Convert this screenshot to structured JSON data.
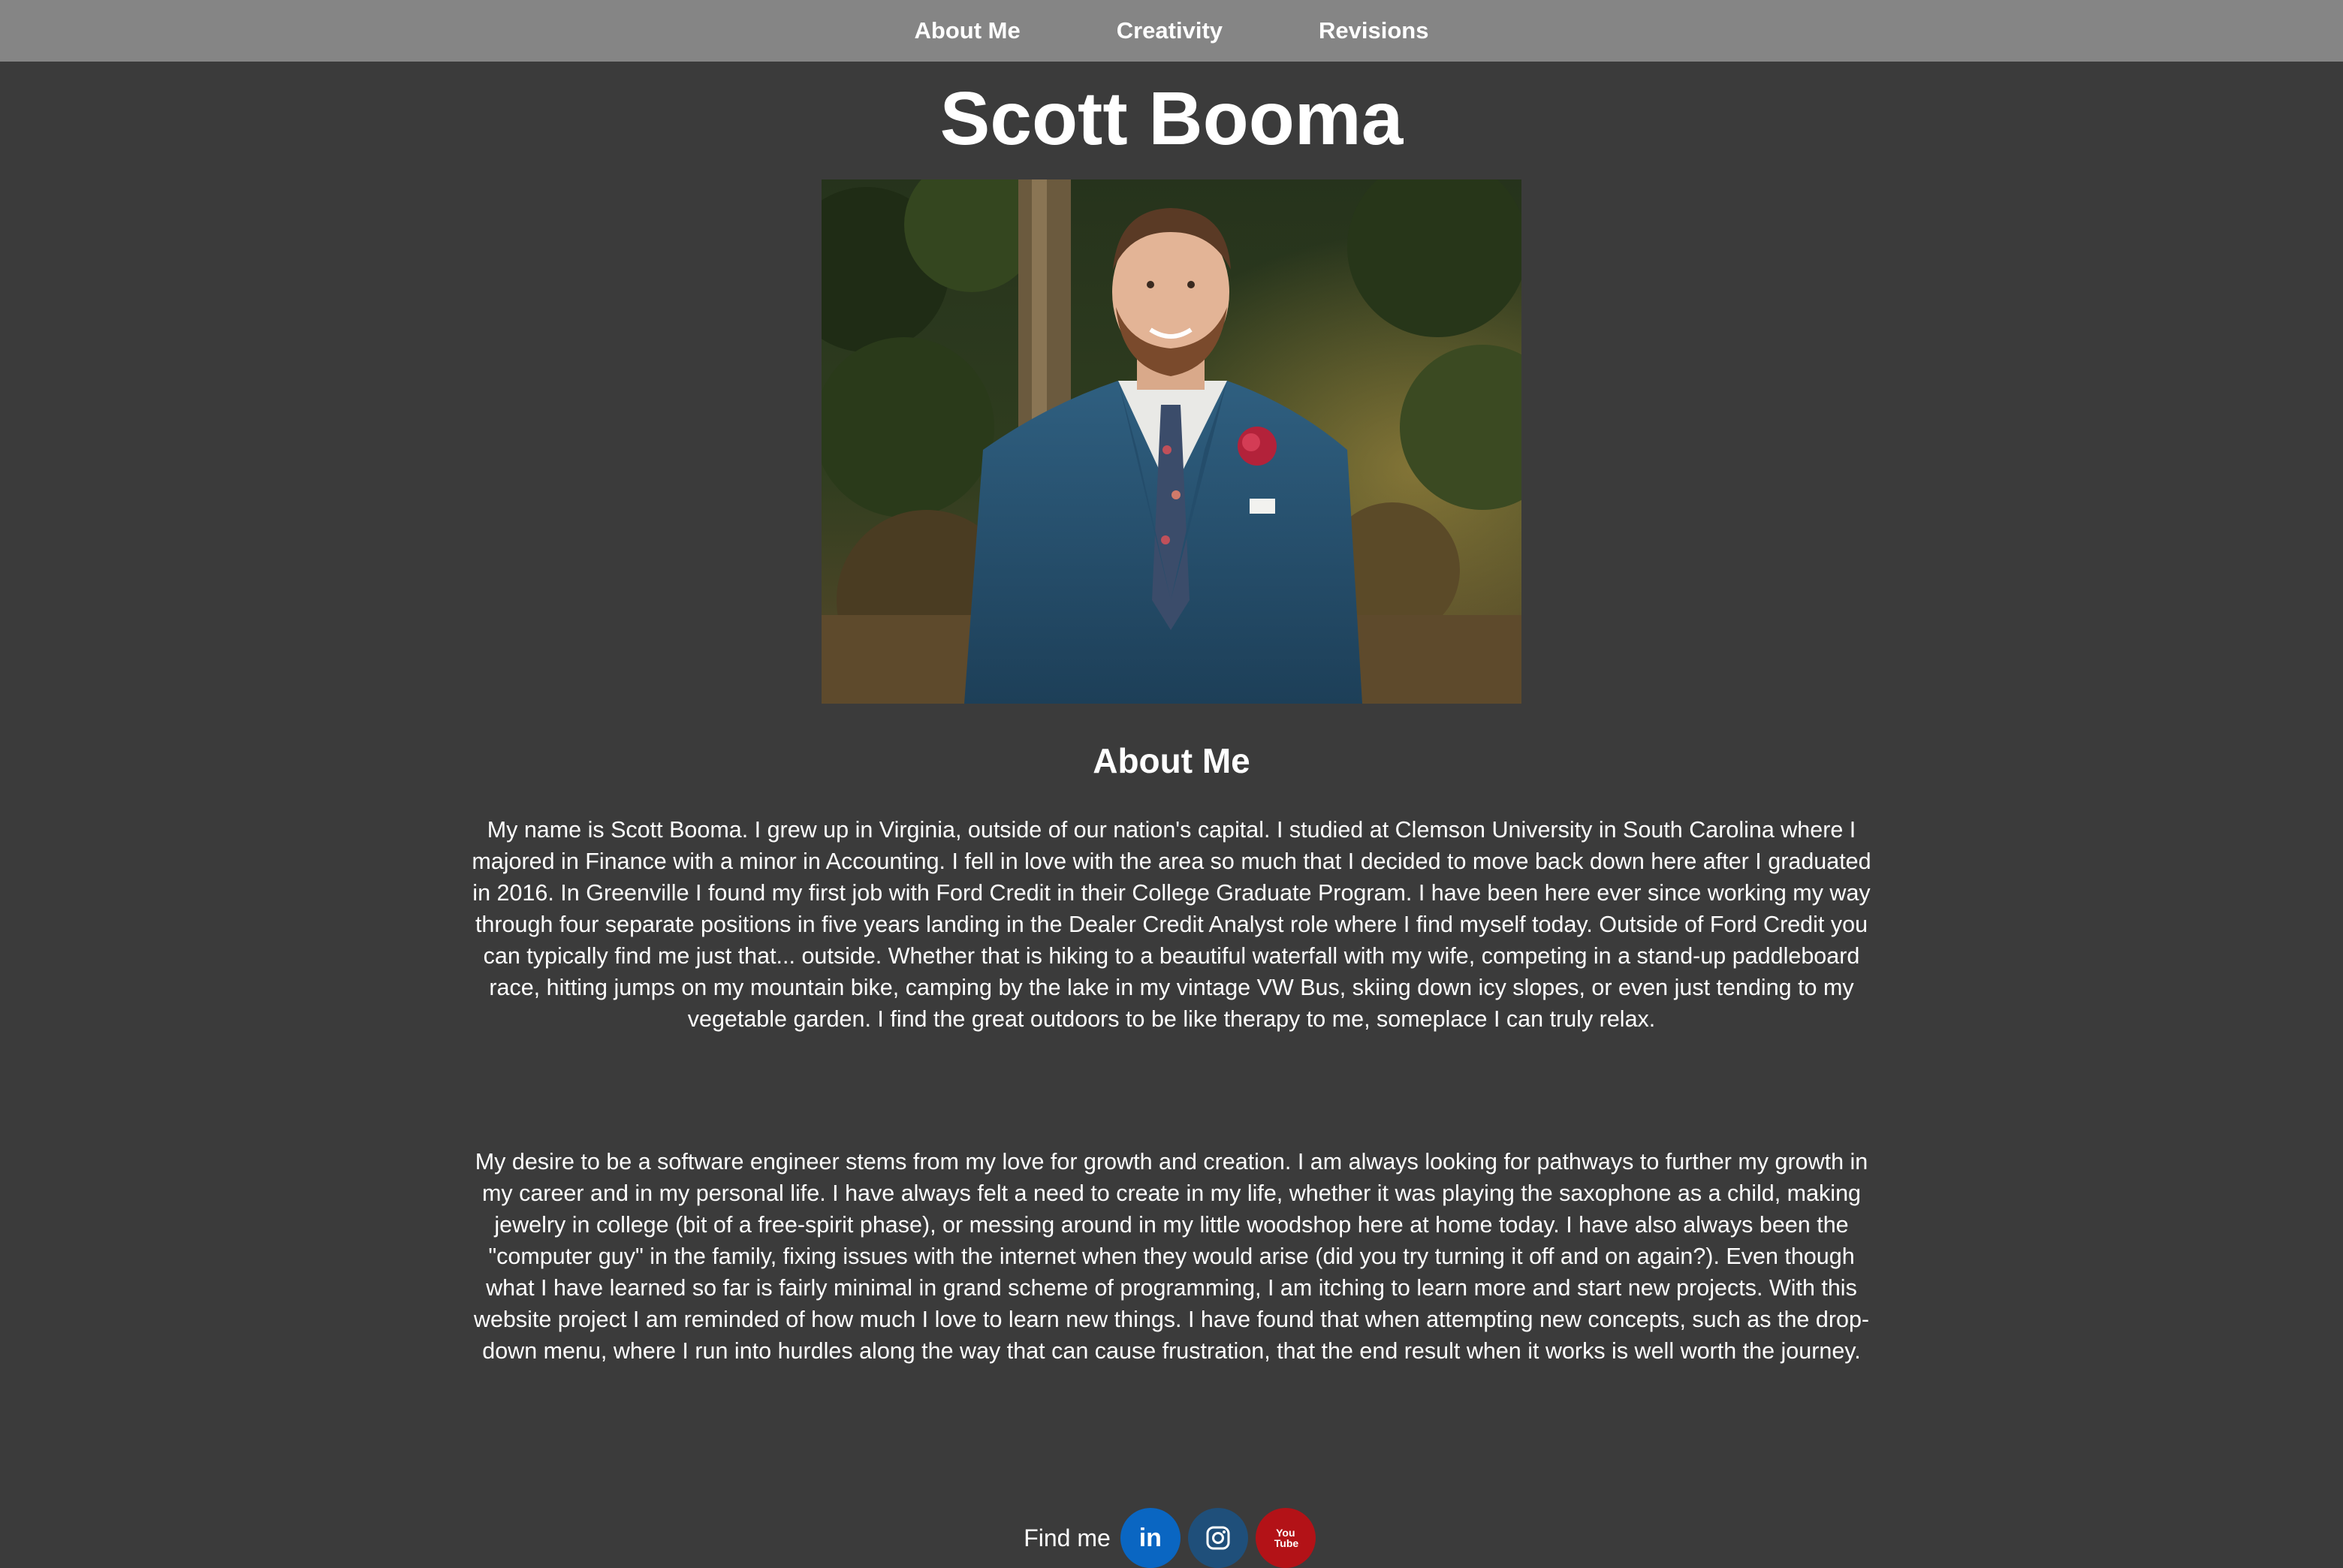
{
  "nav": {
    "items": [
      {
        "label": "About Me"
      },
      {
        "label": "Creativity"
      },
      {
        "label": "Revisions"
      }
    ]
  },
  "header": {
    "title": "Scott Booma"
  },
  "portrait": {
    "icon": "portrait-photo"
  },
  "about": {
    "heading": "About Me",
    "paragraph_1": "My name is Scott Booma. I grew up in Virginia, outside of our nation's capital. I studied at Clemson University in South Carolina where I majored in Finance with a minor in Accounting. I fell in love with the area so much that I decided to move back down here after I graduated in 2016. In Greenville I found my first job with Ford Credit in their College Graduate Program. I have been here ever since working my way through four separate positions in five years landing in the Dealer Credit Analyst role where I find myself today. Outside of Ford Credit you can typically find me just that... outside. Whether that is hiking to a beautiful waterfall with my wife, competing in a stand-up paddleboard race, hitting jumps on my mountain bike, camping by the lake in my vintage VW Bus, skiing down icy slopes, or even just tending to my vegetable garden. I find the great outdoors to be like therapy to me, someplace I can truly relax.",
    "paragraph_2": "My desire to be a software engineer stems from my love for growth and creation. I am always looking for pathways to further my growth in my career and in my personal life. I have always felt a need to create in my life, whether it was playing the saxophone as a child, making jewelry in college (bit of a free-spirit phase), or messing around in my little woodshop here at home today. I have also always been the \"computer guy\" in the family, fixing issues with the internet when they would arise (did you try turning it off and on again?). Even though what I have learned so far is fairly minimal in grand scheme of programming, I am itching to learn more and start new projects. With this website project I am reminded of how much I love to learn new things. I have found that when attempting new concepts, such as the drop-down menu, where I run into hurdles along the way that can cause frustration, that the end result when it works is well worth the journey."
  },
  "footer": {
    "find_label": "Find me",
    "socials": [
      {
        "icon": "linkedin-icon",
        "glyph": "in",
        "color": "#0a66c2"
      },
      {
        "icon": "instagram-icon",
        "glyph": "",
        "color": "#1f4f7a"
      },
      {
        "icon": "youtube-icon",
        "glyph": "You Tube",
        "color": "#b31217"
      }
    ]
  },
  "colors": {
    "background": "#3b3b3b",
    "navbar": "#858585",
    "text": "#ffffff"
  }
}
